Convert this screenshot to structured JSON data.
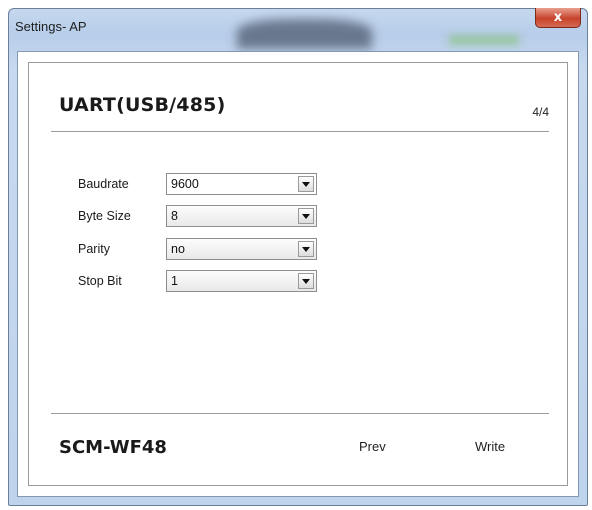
{
  "window": {
    "title": "Settings- AP",
    "close_glyph": "x"
  },
  "panel": {
    "heading": "UART(USB/485)",
    "page_indicator": "4/4"
  },
  "settings": [
    {
      "label": "Baudrate",
      "value": "9600"
    },
    {
      "label": "Byte Size",
      "value": "8"
    },
    {
      "label": "Parity",
      "value": "no"
    },
    {
      "label": "Stop Bit",
      "value": "1"
    }
  ],
  "footer": {
    "product": "SCM-WF48",
    "prev_label": "Prev",
    "write_label": "Write"
  },
  "icons": {
    "close": "close-icon",
    "dropdown": "chevron-down-icon"
  },
  "colors": {
    "frame": "#bed3ec",
    "close_button": "#c7432b"
  }
}
